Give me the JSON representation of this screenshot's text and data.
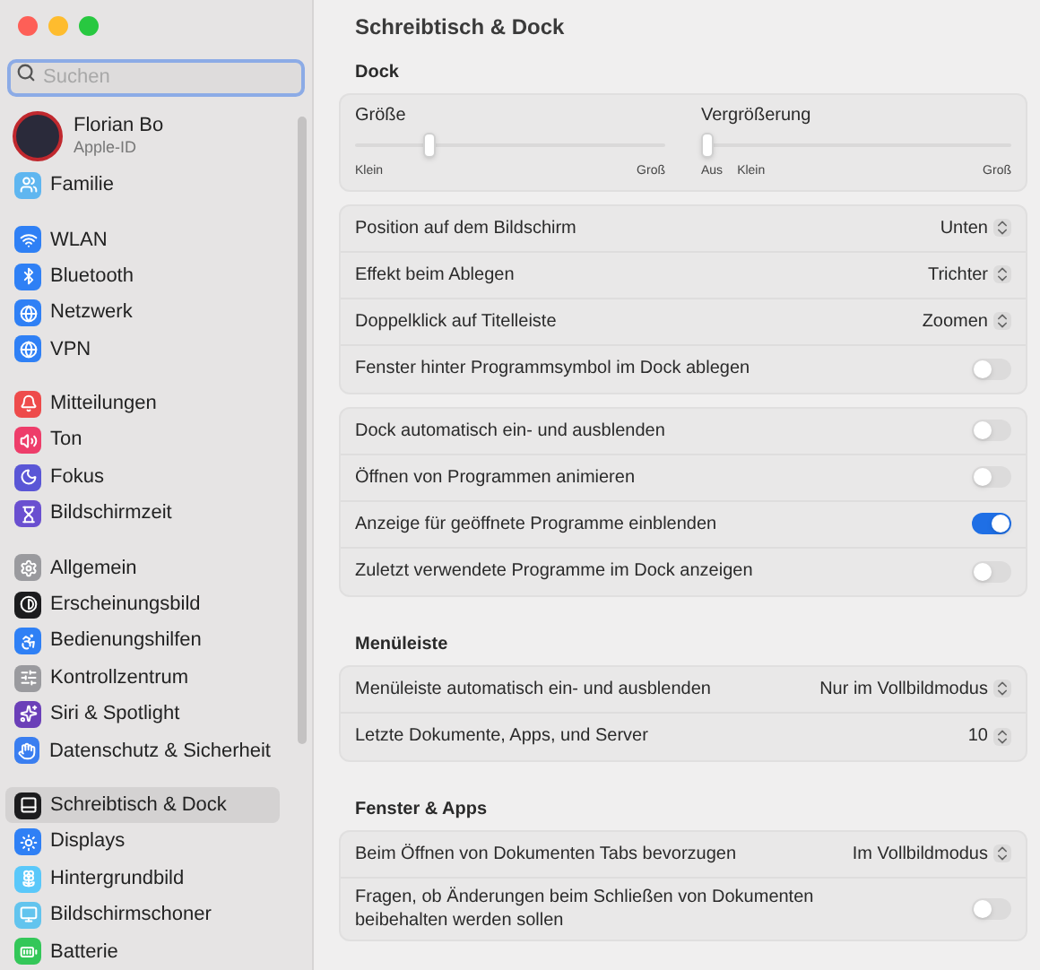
{
  "sidebar": {
    "search": {
      "placeholder": "Suchen"
    },
    "profile": {
      "name": "Florian Bo",
      "subtitle": "Apple-ID"
    },
    "groups": [
      {
        "items": [
          {
            "label": "Familie",
            "color": "#5fb6f0",
            "selected": false
          }
        ]
      },
      {
        "items": [
          {
            "label": "WLAN",
            "color": "#2f80f5",
            "selected": false
          },
          {
            "label": "Bluetooth",
            "color": "#2f80f5",
            "selected": false
          },
          {
            "label": "Netzwerk",
            "color": "#2f80f5",
            "selected": false
          },
          {
            "label": "VPN",
            "color": "#2f80f5",
            "selected": false
          }
        ]
      },
      {
        "items": [
          {
            "label": "Mitteilungen",
            "color": "#ee4b4b",
            "selected": false
          },
          {
            "label": "Ton",
            "color": "#ee3d6a",
            "selected": false
          },
          {
            "label": "Fokus",
            "color": "#5a56d6",
            "selected": false
          },
          {
            "label": "Bildschirmzeit",
            "color": "#6a4fd0",
            "selected": false
          }
        ]
      },
      {
        "items": [
          {
            "label": "Allgemein",
            "color": "#9a9a9e",
            "selected": false
          },
          {
            "label": "Erscheinungsbild",
            "color": "#1c1c1e",
            "selected": false
          },
          {
            "label": "Bedienungshilfen",
            "color": "#2f80f5",
            "selected": false
          },
          {
            "label": "Kontrollzentrum",
            "color": "#9a9a9e",
            "selected": false
          },
          {
            "label": "Siri & Spotlight",
            "color": "#6b3fb8",
            "selected": false
          },
          {
            "label": "Datenschutz & Sicherheit",
            "color": "#3a7ef0",
            "selected": false
          }
        ]
      },
      {
        "items": [
          {
            "label": "Schreibtisch & Dock",
            "color": "#1c1c1e",
            "selected": true
          },
          {
            "label": "Displays",
            "color": "#2f80f5",
            "selected": false
          },
          {
            "label": "Hintergrundbild",
            "color": "#5ac8fa",
            "selected": false
          },
          {
            "label": "Bildschirmschoner",
            "color": "#62c4ee",
            "selected": false
          },
          {
            "label": "Batterie",
            "color": "#34c759",
            "selected": false
          }
        ]
      }
    ]
  },
  "main": {
    "title": "Schreibtisch & Dock",
    "sections": [
      {
        "heading": "Dock",
        "sliders": [
          {
            "label": "Größe",
            "level": 0.23,
            "marks": [
              "Klein",
              "Groß"
            ]
          },
          {
            "label": "Vergrößerung",
            "level": 0,
            "marks": [
              "Aus",
              "Klein",
              "Groß"
            ]
          }
        ],
        "cards": [
          [
            {
              "kind": "select",
              "label": "Position auf dem Bildschirm",
              "value": "Unten"
            },
            {
              "kind": "select",
              "label": "Effekt beim Ablegen",
              "value": "Trichter"
            },
            {
              "kind": "select",
              "label": "Doppelklick auf Titelleiste",
              "value": "Zoomen"
            },
            {
              "kind": "toggle",
              "label": "Fenster hinter Programmsymbol im Dock ablegen",
              "on": false
            }
          ],
          [
            {
              "kind": "toggle",
              "label": "Dock automatisch ein- und ausblenden",
              "on": false
            },
            {
              "kind": "toggle",
              "label": "Öffnen von Programmen animieren",
              "on": false
            },
            {
              "kind": "toggle",
              "label": "Anzeige für geöffnete Programme einblenden",
              "on": true
            },
            {
              "kind": "toggle",
              "label": "Zuletzt verwendete Programme im Dock anzeigen",
              "on": false
            }
          ]
        ]
      },
      {
        "heading": "Menüleiste",
        "cards": [
          [
            {
              "kind": "select",
              "label": "Menüleiste automatisch ein- und ausblenden",
              "value": "Nur im Vollbildmodus"
            },
            {
              "kind": "select",
              "label": "Letzte Dokumente, Apps, und Server",
              "value": "10"
            }
          ]
        ]
      },
      {
        "heading": "Fenster & Apps",
        "cards": [
          [
            {
              "kind": "select",
              "label": "Beim Öffnen von Dokumenten Tabs bevorzugen",
              "value": "Im Vollbildmodus"
            },
            {
              "kind": "toggle",
              "label": "Fragen, ob Änderungen beim Schließen von Dokumenten beibehalten werden sollen",
              "on": false
            }
          ]
        ]
      }
    ]
  }
}
